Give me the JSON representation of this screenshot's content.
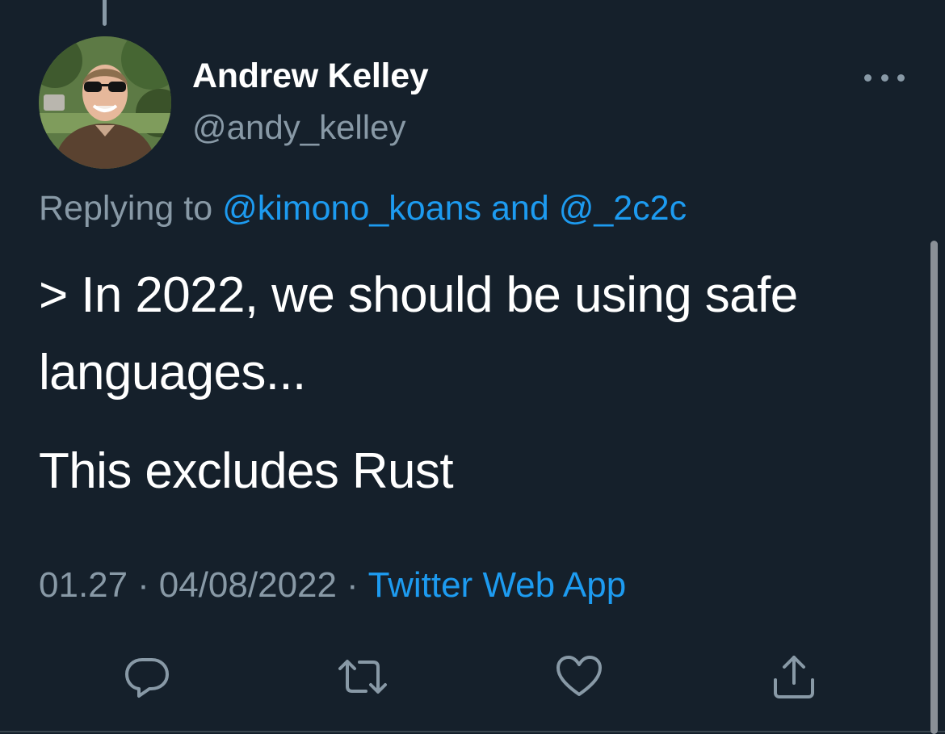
{
  "tweet": {
    "author": {
      "display_name": "Andrew Kelley",
      "handle": "@andy_kelley"
    },
    "reply_context": {
      "prefix": "Replying to",
      "mention_1": "@kimono_koans",
      "conjunction": "and",
      "mention_2": "@_2c2c"
    },
    "body": {
      "line_1": "> In 2022, we should be using safe languages...",
      "line_2": "This excludes Rust"
    },
    "meta": {
      "time": "01.27",
      "separator": "·",
      "date": "04/08/2022",
      "source": "Twitter Web App"
    },
    "actions": {
      "reply_icon": "reply-icon",
      "retweet_icon": "retweet-icon",
      "like_icon": "heart-icon",
      "share_icon": "share-icon"
    }
  },
  "colors": {
    "background": "#15202b",
    "text_primary": "#ffffff",
    "text_secondary": "#8899a6",
    "link": "#1d9bf0"
  }
}
